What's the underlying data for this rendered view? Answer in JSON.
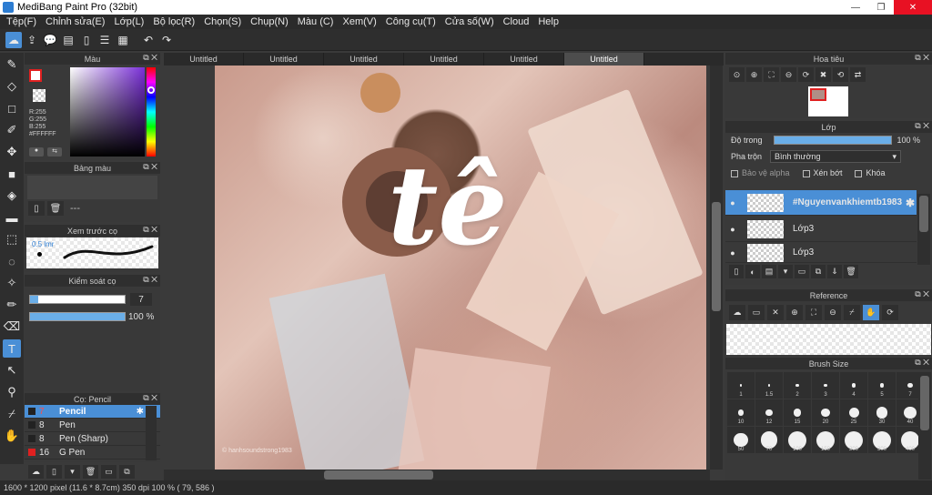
{
  "window": {
    "title": "MediBang Paint Pro (32bit)",
    "controls": [
      "—",
      "❐",
      "✕"
    ]
  },
  "menu": [
    "Tệp(F)",
    "Chỉnh sửa(E)",
    "Lớp(L)",
    "Bộ lọc(R)",
    "Chọn(S)",
    "Chụp(N)",
    "Màu (C)",
    "Xem(V)",
    "Công cụ(T)",
    "Cửa số(W)",
    "Cloud",
    "Help"
  ],
  "toolbar_icons": [
    "cloud-icon",
    "export-icon",
    "comment-icon",
    "comment-list-icon",
    "page-icon",
    "page-list-icon",
    "grid-icon",
    "undo-icon",
    "redo-icon"
  ],
  "left_tools": [
    "brush-icon",
    "eraser-icon",
    "rectangle-icon",
    "select-pen-icon",
    "move-icon",
    "fill-rect-icon",
    "bucket-icon",
    "gradient-icon",
    "marquee-icon",
    "lasso-icon",
    "magic-wand-icon",
    "select-brush-icon",
    "select-eraser-icon",
    "text-icon",
    "operation-icon",
    "eyedropper-icon",
    "dropper-icon",
    "hand-icon"
  ],
  "color_panel": {
    "title": "Màu",
    "rgb_lines": [
      "R:255",
      "G:255",
      "B:255",
      "#FFFFFF"
    ],
    "foreground": "#FFFFFF",
    "accent": "#7A2FD8"
  },
  "palette_panel": {
    "title": "Bảng màu",
    "placeholder": "---"
  },
  "brush_preview": {
    "title": "Xem trước cọ",
    "size_label": "0.5 lmr"
  },
  "brush_control": {
    "title": "Kiểm soát cọ",
    "size_value": "7",
    "opacity_value": "100 %",
    "size_fraction": 0.09,
    "opacity_fraction": 1.0
  },
  "brush_list": {
    "title": "Cọ: Pencil",
    "items": [
      {
        "num": "7",
        "name": "Pencil",
        "selected": true
      },
      {
        "num": "8",
        "name": "Pen",
        "selected": false
      },
      {
        "num": "8",
        "name": "Pen (Sharp)",
        "selected": false
      },
      {
        "num": "16",
        "name": "G Pen",
        "selected": false
      }
    ]
  },
  "tabs": [
    "Untitled",
    "Untitled",
    "Untitled",
    "Untitled",
    "Untitled",
    "Untitled"
  ],
  "active_tab": 5,
  "canvas": {
    "big_text": "tê",
    "stamp": "© hanhsoundstrong1983"
  },
  "status": "1600 * 1200 pixel   (11.6 * 8.7cm)   350 dpi   100 %   ( 79, 586 )",
  "navigator": {
    "title": "Hoa tiêu"
  },
  "layers": {
    "title": "Lớp",
    "opacity_label": "Độ trong",
    "opacity_value": "100 %",
    "opacity_fraction": 1.0,
    "blend_label": "Pha trộn",
    "blend_value": "Bình thường",
    "protect_alpha": "Bảo vệ alpha",
    "clipping": "Xén bớt",
    "lock": "Khóa",
    "items": [
      {
        "name": "#Nguyenvankhiemtb1983",
        "selected": true
      },
      {
        "name": "Lớp3",
        "selected": false
      },
      {
        "name": "Lớp3",
        "selected": false
      }
    ]
  },
  "reference": {
    "title": "Reference"
  },
  "brush_size": {
    "title": "Brush Size",
    "sizes": [
      "1",
      "1.5",
      "2",
      "3",
      "4",
      "5",
      "7",
      "10",
      "12",
      "15",
      "20",
      "25",
      "30",
      "40",
      "50",
      "70",
      "100",
      "150",
      "200",
      "300",
      "400"
    ]
  },
  "colors": {
    "accent": "#4A8FD6",
    "panel": "#393939",
    "close": "#E81123"
  }
}
